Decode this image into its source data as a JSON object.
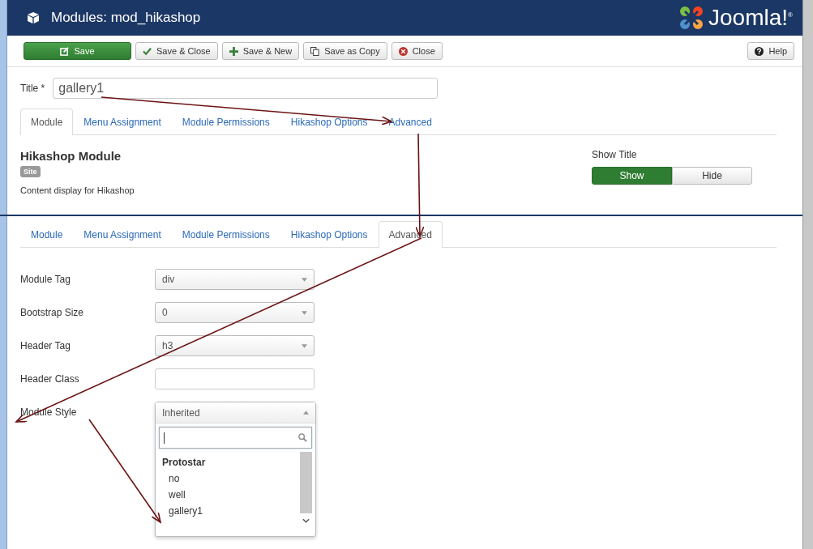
{
  "window": {
    "title": "Modules: mod_hikashop",
    "logo": "Joomla!$^{®}$"
  },
  "toolbar": [
    {
      "label": "Save",
      "kind": "save"
    },
    {
      "label": "Save & Close",
      "kind": "check"
    },
    {
      "label": "Save & New",
      "kind": "new"
    },
    {
      "label": "Save as Copy",
      "kind": "copy"
    },
    {
      "label": "Close",
      "kind": "close"
    }
  ],
  "help_button": "Help",
  "title_field": {
    "label": "Title *",
    "value": "gallery1"
  },
  "tabs_top": [
    {
      "label": "Module",
      "selected": true
    },
    {
      "label": "Menu Assignment",
      "selected": false
    },
    {
      "label": "Module Permissions",
      "selected": false
    },
    {
      "label": "Hikashop Options",
      "selected": false
    },
    {
      "label": "Advanced",
      "selected": false
    }
  ],
  "module": {
    "name": "Hikashop Module",
    "badge": "Site",
    "description": "Content display for Hikashop"
  },
  "show_title": {
    "label": "Show Title",
    "options": [
      {
        "label": "Show",
        "selected": true
      },
      {
        "label": "Hide",
        "selected": false
      }
    ]
  },
  "tabs_bottom": [
    {
      "label": "Module",
      "selected": false
    },
    {
      "label": "Menu Assignment",
      "selected": false
    },
    {
      "label": "Module Permissions",
      "selected": false
    },
    {
      "label": "Hikashop Options",
      "selected": false
    },
    {
      "label": "Advanced",
      "selected": true
    }
  ],
  "fields": [
    {
      "label": "Module Tag",
      "kind": "select",
      "value": "div"
    },
    {
      "label": "Bootstrap Size",
      "kind": "select",
      "value": "0"
    },
    {
      "label": "Header Tag",
      "kind": "select",
      "value": "h3"
    },
    {
      "label": "Header Class",
      "kind": "text"
    },
    {
      "label": "Module Style",
      "kind": "open-select",
      "value": "Inherited",
      "group": "Protostar",
      "options": [
        "no",
        "well",
        "gallery1"
      ]
    }
  ]
}
